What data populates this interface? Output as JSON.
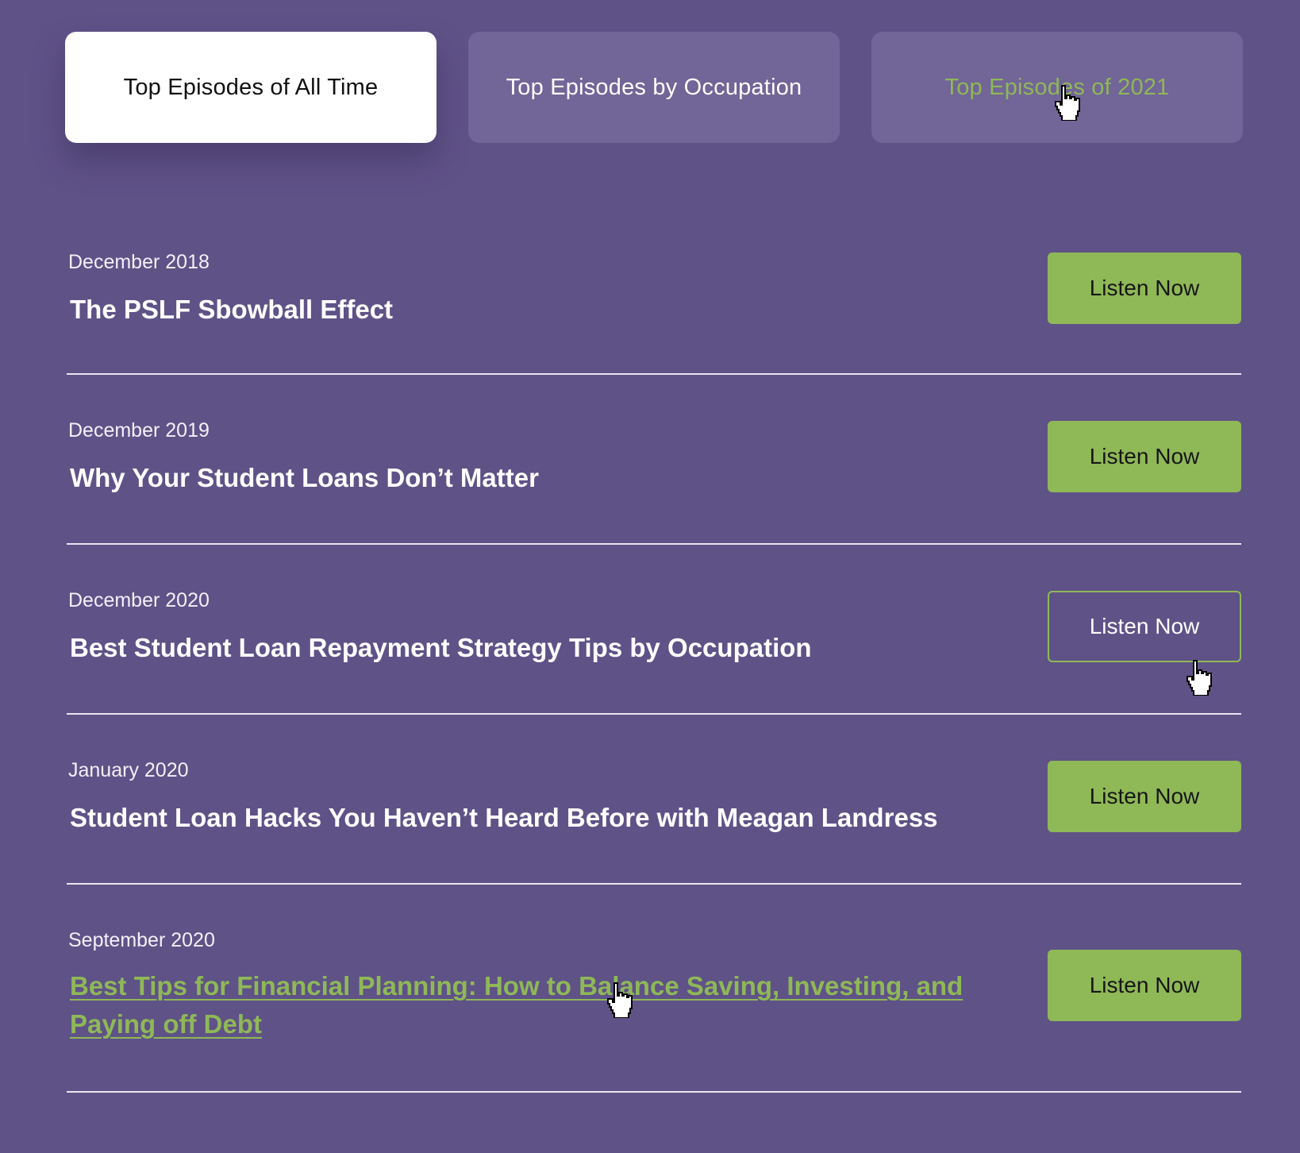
{
  "tabs": [
    {
      "label": "Top Episodes of All Time",
      "state": "active"
    },
    {
      "label": "Top Episodes by Occupation",
      "state": "inactive"
    },
    {
      "label": "Top Episodes of 2021",
      "state": "hover"
    }
  ],
  "episodes": [
    {
      "date": "December 2018",
      "title": "The PSLF Sbowball Effect",
      "button": "Listen Now"
    },
    {
      "date": "December 2019",
      "title": "Why Your Student Loans Don’t Matter",
      "button": "Listen Now"
    },
    {
      "date": "December 2020",
      "title": "Best Student Loan Repayment Strategy Tips by Occupation",
      "button": "Listen Now"
    },
    {
      "date": "January 2020",
      "title": "Student Loan Hacks You Haven’t Heard Before with Meagan Landress",
      "button": "Listen Now"
    },
    {
      "date": "September 2020",
      "title": "Best Tips for Financial Planning: How to Balance Saving, Investing, and Paying off Debt",
      "button": "Listen Now"
    }
  ],
  "colors": {
    "background": "#5f5287",
    "accent_green": "#8fb857",
    "tab_inactive": "#726597"
  },
  "icons": [
    "hand-pointer-cursor-icon"
  ]
}
